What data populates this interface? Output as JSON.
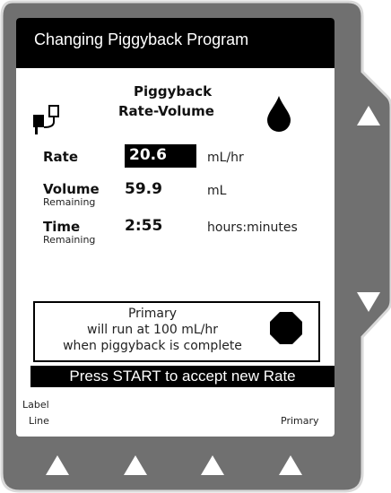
{
  "title": "Changing Piggyback Program",
  "mode": {
    "line1": "Piggyback",
    "line2": "Rate-Volume"
  },
  "rate": {
    "label": "Rate",
    "value": "20.6",
    "unit": "mL/hr"
  },
  "volume": {
    "label": "Volume",
    "sublabel": "Remaining",
    "value": "59.9",
    "unit": "mL"
  },
  "time": {
    "label": "Time",
    "sublabel": "Remaining",
    "value": "2:55",
    "unit": "hours:minutes"
  },
  "notice": {
    "line1": "Primary",
    "line2": "will run at 100 mL/hr",
    "line3": "when piggyback is complete"
  },
  "prompt": "Press START to accept new Rate",
  "softkeys": {
    "left_label_top": "Label",
    "left_label_bottom": "Line",
    "right_label": "Primary"
  },
  "icons": {
    "drop": "drop-icon",
    "iv": "iv-bag-icon",
    "stop": "stop-octagon-icon",
    "up": "up-arrow-icon",
    "down": "down-arrow-icon",
    "softkey": "softkey-up-arrow-icon"
  },
  "colors": {
    "bezel": "#707070",
    "bezel_border": "#d9d9d9",
    "screen": "#ffffff",
    "bar": "#000000"
  }
}
